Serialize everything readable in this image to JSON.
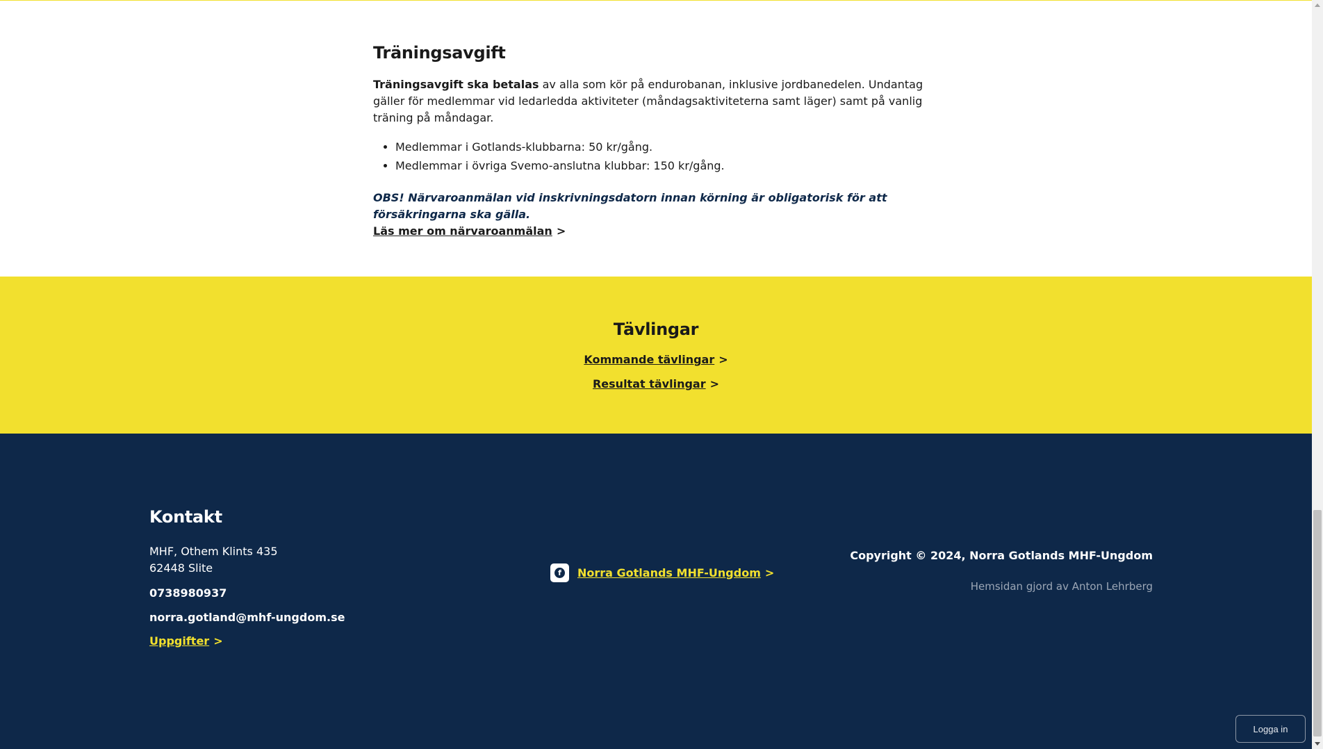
{
  "colors": {
    "accent_yellow": "#f2e02e",
    "navy": "#0e2849",
    "text_dark": "#1a1a1a",
    "muted_gray": "#9ba6b5"
  },
  "training": {
    "title": "Träningsavgift",
    "intro_bold": "Träningsavgift ska betalas",
    "intro_rest": " av alla som kör på endurobanan, inklusive jordbanedelen. Undantag gäller för medlemmar vid ledarledda aktiviteter (måndagsaktiviteterna samt läger) samt på vanlig träning på måndagar.",
    "fees": [
      "Medlemmar i Gotlands-klubbarna: 50 kr/gång.",
      "Medlemmar i övriga Svemo-anslutna klubbar: 150 kr/gång."
    ],
    "obs": "OBS! Närvaroanmälan vid inskrivningsdatorn innan körning är obligatorisk för att försäkringarna ska gälla.",
    "read_more_link": "Läs mer om närvaroanmälan",
    "arrow": ">"
  },
  "competitions": {
    "title": "Tävlingar",
    "upcoming_link": "Kommande tävlingar",
    "results_link": "Resultat tävlingar",
    "arrow": ">"
  },
  "footer": {
    "contact": {
      "title": "Kontakt",
      "address_line1": "MHF, Othem Klints 435",
      "address_line2": "62448 Slite",
      "phone": "0738980937",
      "email": "norra.gotland@mhf-ungdom.se",
      "details_link": "Uppgifter",
      "arrow": ">"
    },
    "facebook": {
      "icon": "facebook-icon",
      "link": "Norra Gotlands MHF-Ungdom",
      "arrow": ">"
    },
    "copyright": "Copyright © 2024, Norra Gotlands MHF-Ungdom",
    "credit": "Hemsidan gjord av Anton Lehrberg"
  },
  "login_button": "Logga in"
}
